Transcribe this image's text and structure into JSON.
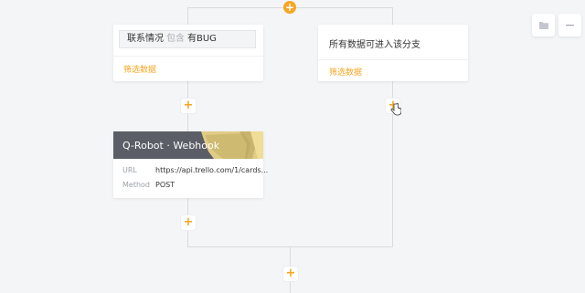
{
  "condition_card": {
    "field": "联系情况",
    "operator": "包含",
    "value": "有BUG",
    "filter_link": "筛选数据"
  },
  "branch_card": {
    "text": "所有数据可进入该分支",
    "filter_link": "筛选数据"
  },
  "webhook_card": {
    "title": "Q-Robot · Webhook",
    "url_label": "URL",
    "url_value": "https://api.trello.com/1/cards...",
    "method_label": "Method",
    "method_value": "POST"
  },
  "add_buttons": {
    "symbol": "+"
  },
  "toolbar": {
    "folder_icon": "folder-icon",
    "minus_symbol": "−"
  },
  "colors": {
    "accent": "#f5a623",
    "webhook_header": "#5b5e66",
    "line": "#d9dbe0"
  }
}
